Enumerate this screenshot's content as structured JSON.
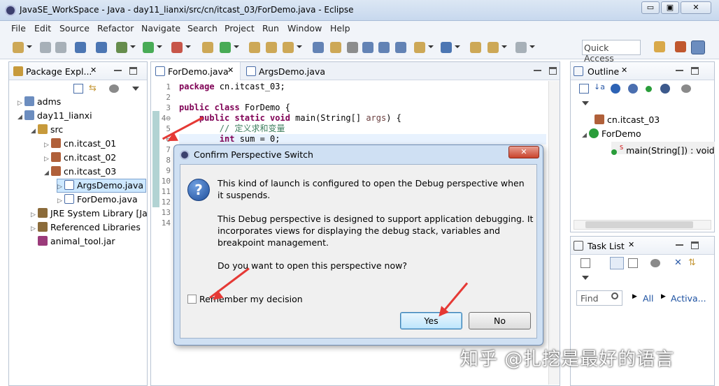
{
  "window": {
    "title": "JavaSE_WorkSpace - Java - day11_lianxi/src/cn/itcast_03/ForDemo.java - Eclipse",
    "minimize": "▭",
    "maximize": "▣",
    "close": "✕"
  },
  "menu": [
    "File",
    "Edit",
    "Source",
    "Refactor",
    "Navigate",
    "Search",
    "Project",
    "Run",
    "Window",
    "Help"
  ],
  "toolbar": {
    "quick_access": "Quick Access"
  },
  "package_explorer": {
    "tab": "Package Expl...",
    "tree": [
      {
        "label": "adms",
        "depth": 0,
        "twist": "▷",
        "icon": "project-icon"
      },
      {
        "label": "day11_lianxi",
        "depth": 0,
        "twist": "◢",
        "icon": "project-icon"
      },
      {
        "label": "src",
        "depth": 1,
        "twist": "◢",
        "icon": "source-folder-icon"
      },
      {
        "label": "cn.itcast_01",
        "depth": 2,
        "twist": "▷",
        "icon": "package-icon"
      },
      {
        "label": "cn.itcast_02",
        "depth": 2,
        "twist": "▷",
        "icon": "package-icon"
      },
      {
        "label": "cn.itcast_03",
        "depth": 2,
        "twist": "◢",
        "icon": "package-icon"
      },
      {
        "label": "ArgsDemo.java",
        "depth": 3,
        "twist": "▷",
        "icon": "java-file-icon",
        "selected": true
      },
      {
        "label": "ForDemo.java",
        "depth": 3,
        "twist": "▷",
        "icon": "java-file-icon"
      },
      {
        "label": "JRE System Library [Ja",
        "depth": 1,
        "twist": "▷",
        "icon": "library-icon"
      },
      {
        "label": "Referenced Libraries",
        "depth": 1,
        "twist": "▷",
        "icon": "library-icon"
      },
      {
        "label": "animal_tool.jar",
        "depth": 1,
        "twist": "",
        "icon": "jar-icon"
      }
    ]
  },
  "editor": {
    "tabs": [
      {
        "label": "ForDemo.java",
        "active": true
      },
      {
        "label": "ArgsDemo.java",
        "active": false
      }
    ],
    "lines": [
      {
        "n": "1",
        "html": "<span class=\"kw\">package</span> cn.itcast_03;"
      },
      {
        "n": "2",
        "html": ""
      },
      {
        "n": "3",
        "html": "<span class=\"kw\">public class</span> ForDemo {"
      },
      {
        "n": "4⊖",
        "html": "    <span class=\"kw\">public static void</span> main(String[] <span class=\"param\">args</span>) {"
      },
      {
        "n": "5",
        "html": "        <span class=\"cm\">// 定义求和变量</span>"
      },
      {
        "n": "6",
        "html": "        <span class=\"kw\">int</span> sum = 0;"
      },
      {
        "n": "7",
        "html": ""
      },
      {
        "n": "8",
        "html": ""
      },
      {
        "n": "9",
        "html": ""
      },
      {
        "n": "10",
        "html": ""
      },
      {
        "n": "11",
        "html": ""
      },
      {
        "n": "12",
        "html": ""
      },
      {
        "n": "13",
        "html": ""
      },
      {
        "n": "14",
        "html": ""
      }
    ]
  },
  "outline": {
    "tab": "Outline",
    "items": [
      {
        "label": "cn.itcast_03",
        "icon": "package-icon"
      },
      {
        "label": "ForDemo",
        "icon": "class-icon"
      },
      {
        "label": "main(String[]) : void",
        "icon": "method-icon"
      }
    ]
  },
  "task_list": {
    "tab": "Task List",
    "find": "Find",
    "all": "All",
    "activate": "Activa..."
  },
  "dialog": {
    "title": "Confirm Perspective Switch",
    "para1": "This kind of launch is configured to open the Debug perspective when it suspends.",
    "para2": "This Debug perspective is designed to support application debugging.  It incorporates views for displaying the debug stack, variables and breakpoint management.",
    "question": "Do you want to open this perspective now?",
    "remember": "Remember my decision",
    "remember_checked": false,
    "yes": "Yes",
    "no": "No",
    "close": "✕"
  },
  "watermark": "知乎 @扎挖是最好的语言",
  "colors": {
    "arrow": "#e53935",
    "dialog_frame": "#cfe0f3",
    "selection": "#cde8ff"
  }
}
